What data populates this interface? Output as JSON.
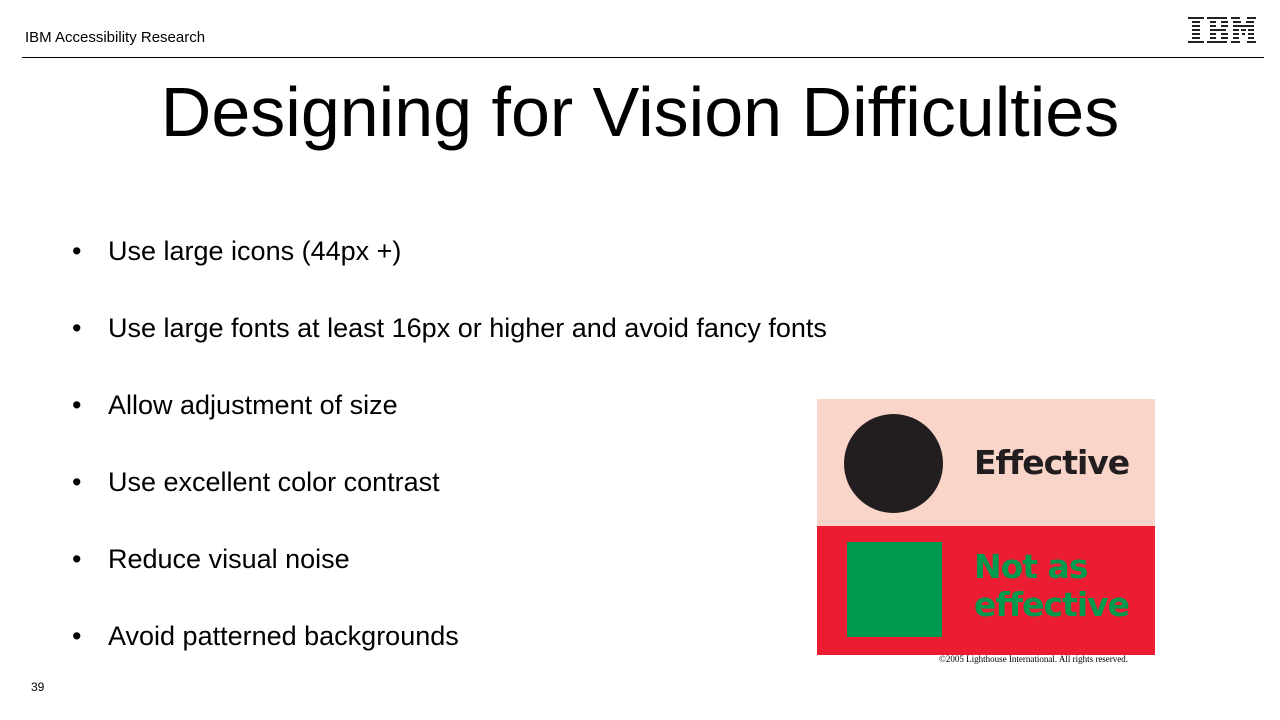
{
  "header": {
    "label": "IBM Accessibility Research",
    "logo": "ibm-logo"
  },
  "slide": {
    "title": "Designing for Vision Difficulties",
    "bullet_glyph": "•",
    "bullets": [
      "Use large icons (44px +)",
      "Use large fonts at least 16px or higher and avoid fancy fonts",
      "Allow adjustment of size",
      "Use excellent color contrast",
      "Reduce visual noise",
      "Avoid patterned backgrounds"
    ]
  },
  "figure": {
    "effective_label": "Effective",
    "not_effective_line1": "Not as",
    "not_effective_line2": "effective",
    "copyright": "©2005 Lighthouse International. All rights reserved.",
    "colors": {
      "effective_bg": "#f9d4c8",
      "effective_fg": "#221e1f",
      "not_effective_bg": "#ec1d32",
      "not_effective_fg": "#009a4e"
    }
  },
  "footer": {
    "page_number": "39"
  }
}
